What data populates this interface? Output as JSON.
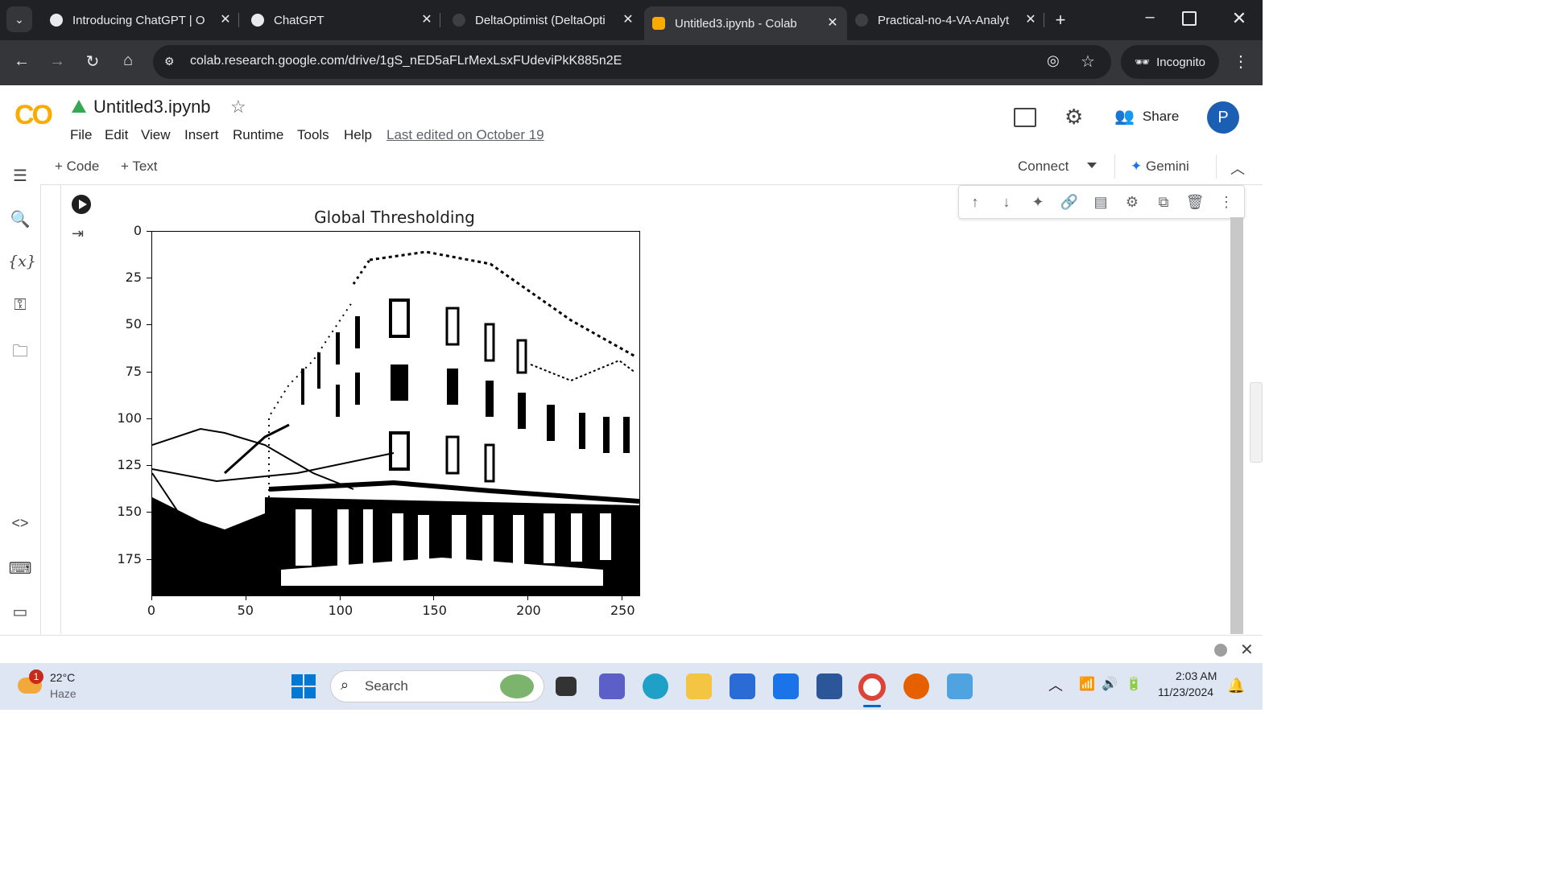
{
  "browser": {
    "tabs": [
      {
        "title": "Introducing ChatGPT | Op",
        "active": false
      },
      {
        "title": "ChatGPT",
        "active": false
      },
      {
        "title": "DeltaOptimist (DeltaOpti",
        "active": false
      },
      {
        "title": "Untitled3.ipynb - Colab",
        "active": true
      },
      {
        "title": "Practical-no-4-VA-Analyt",
        "active": false
      }
    ],
    "url": "colab.research.google.com/drive/1gS_nED5aFLrMexLsxFUdeviPkK885n2E",
    "incognito_label": "Incognito"
  },
  "colab": {
    "logo": "CO",
    "notebook_title": "Untitled3.ipynb",
    "menu": [
      "File",
      "Edit",
      "View",
      "Insert",
      "Runtime",
      "Tools",
      "Help"
    ],
    "last_edited": "Last edited on October 19",
    "share_label": "Share",
    "avatar_initial": "P",
    "add_code": "+ Code",
    "add_text": "+ Text",
    "connect_label": "Connect",
    "gemini_label": "Gemini"
  },
  "chart_data": {
    "type": "image",
    "title": "Global Thresholding",
    "xticks": [
      "0",
      "50",
      "100",
      "150",
      "200",
      "250"
    ],
    "yticks": [
      "0",
      "25",
      "50",
      "75",
      "100",
      "125",
      "150",
      "175"
    ],
    "xlim": [
      0,
      259
    ],
    "ylim": [
      194,
      0
    ],
    "content": "binary thresholded image of a building"
  },
  "taskbar": {
    "weather_temp": "22°C",
    "weather_desc": "Haze",
    "weather_badge": "1",
    "search_placeholder": "Search",
    "time": "2:03 AM",
    "date": "11/23/2024"
  }
}
